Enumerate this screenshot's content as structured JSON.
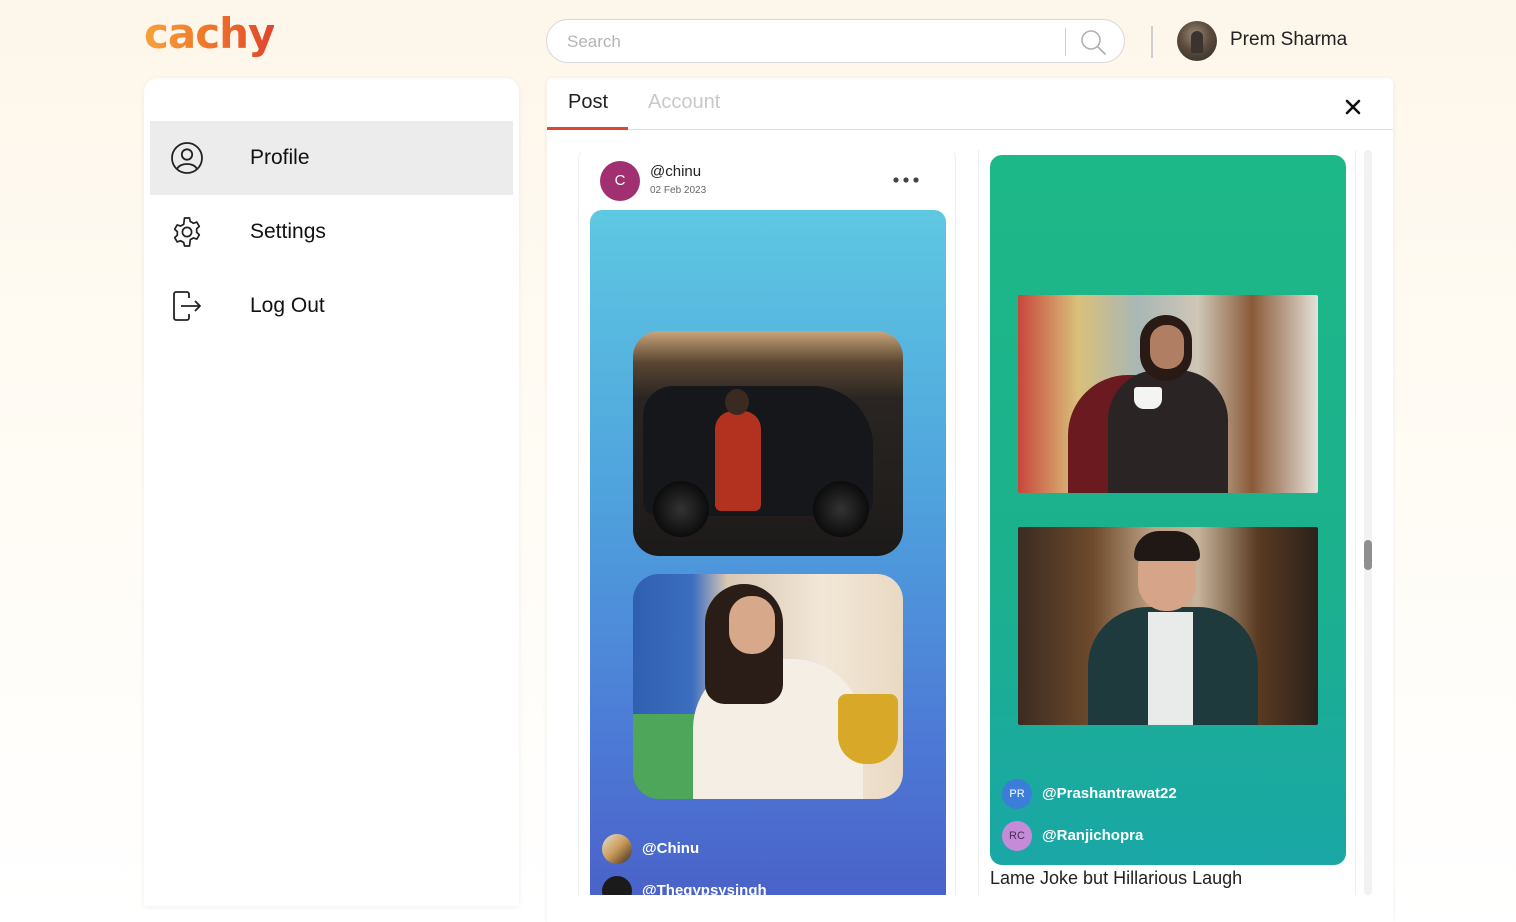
{
  "header": {
    "logo_text": "cachy",
    "search_placeholder": "Search",
    "user_name": "Prem Sharma"
  },
  "sidebar": {
    "items": [
      {
        "label": "Profile",
        "icon": "user-circle-icon",
        "active": true
      },
      {
        "label": "Settings",
        "icon": "gear-icon",
        "active": false
      },
      {
        "label": "Log Out",
        "icon": "logout-icon",
        "active": false
      }
    ]
  },
  "panel": {
    "tabs": [
      {
        "label": "Post",
        "active": true
      },
      {
        "label": "Account",
        "active": false
      }
    ],
    "close_icon": "close-icon"
  },
  "posts": {
    "left": {
      "avatar_initial": "C",
      "username": "@chinu",
      "date": "02 Feb 2023",
      "tags": [
        "@Chinu",
        "@Thegypsysingh"
      ]
    },
    "right": {
      "mentions": [
        {
          "initials": "PR",
          "name": "@Prashantrawat22"
        },
        {
          "initials": "RC",
          "name": "@Ranjichopra"
        }
      ],
      "caption": "Lame Joke but Hillarious Laugh"
    }
  },
  "colors": {
    "accent": "#e0452f",
    "active_item_bg": "#ececec",
    "card_blue_top": "#5ec8e2",
    "card_blue_bottom": "#4a60c8",
    "card_teal": "#1db887"
  }
}
